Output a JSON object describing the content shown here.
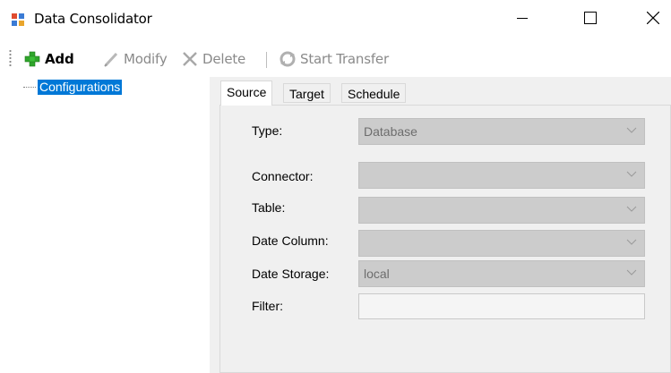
{
  "window": {
    "title": "Data Consolidator",
    "controls": {
      "minimize": "minimize-icon",
      "maximize": "maximize-icon",
      "close": "close-icon"
    }
  },
  "toolbar": {
    "add_label": "Add",
    "modify_label": "Modify",
    "delete_label": "Delete",
    "start_transfer_label": "Start Transfer"
  },
  "tree": {
    "root_label": "Configurations"
  },
  "tabs": [
    {
      "label": "Source",
      "selected": true
    },
    {
      "label": "Target",
      "selected": false
    },
    {
      "label": "Schedule",
      "selected": false
    }
  ],
  "source_form": {
    "type_label": "Type:",
    "type_value": "Database",
    "connector_label": "Connector:",
    "connector_value": "",
    "table_label": "Table:",
    "table_value": "",
    "date_column_label": "Date Column:",
    "date_column_value": "",
    "date_storage_label": "Date Storage:",
    "date_storage_value": "local",
    "filter_label": "Filter:",
    "filter_value": ""
  },
  "colors": {
    "selection": "#0078d7",
    "disabled_text": "#8a8a8a",
    "disabled_field": "#cccccc",
    "add_icon_green": "#2fa52b"
  }
}
